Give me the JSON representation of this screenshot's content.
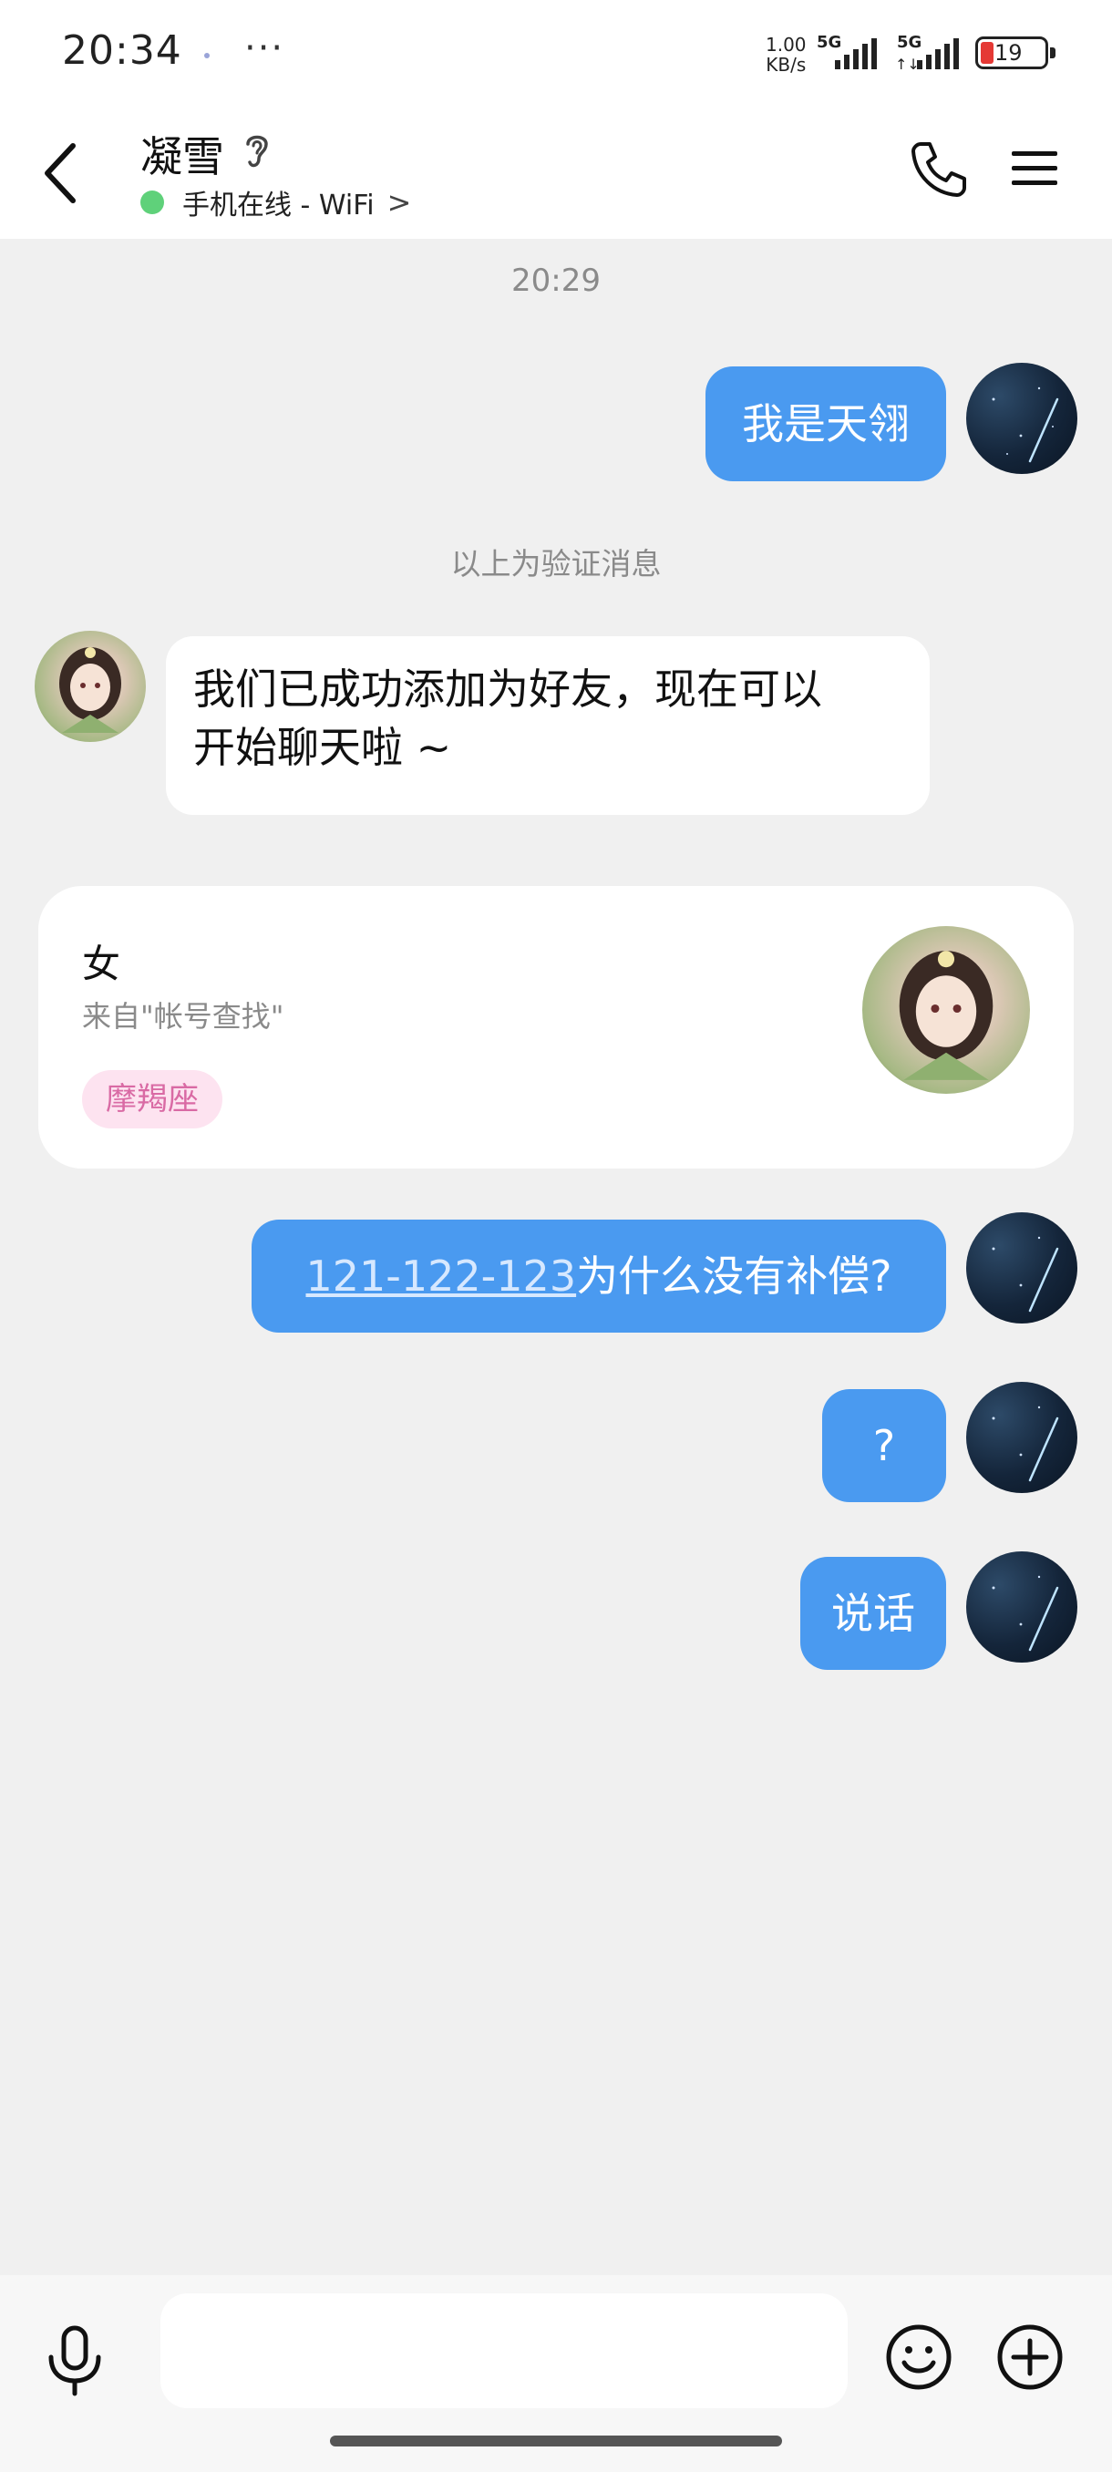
{
  "status_bar": {
    "time": "20:34",
    "more": "···",
    "speed_value": "1.00",
    "speed_unit": "KB/s",
    "network1": "5G",
    "network2": "5G",
    "battery": "19",
    "battery_color": "#e53935"
  },
  "header": {
    "contact_name": "凝雪",
    "online_status": "手机在线 - WiFi",
    "online_chevron": ">",
    "online_color": "#5fd17a",
    "icons": [
      "back-icon",
      "ear-icon",
      "phone-icon",
      "menu-icon"
    ]
  },
  "chat": {
    "timestamp": "20:29",
    "verify_note": "以上为验证消息",
    "messages": [
      {
        "from": "self",
        "text": "我是天翎"
      },
      {
        "from": "friend",
        "text_line1": "我们已成功添加为好友，现在可以",
        "text_line2": "开始聊天啦 ~"
      },
      {
        "from": "self",
        "link": "121-122-123",
        "text": "为什么没有补偿?"
      },
      {
        "from": "self",
        "text": "?"
      },
      {
        "from": "self",
        "text": "说话"
      }
    ],
    "bubble_color": "#4a9af0"
  },
  "profile_card": {
    "gender": "女",
    "source": "来自\"帐号查找\"",
    "tag": "摩羯座",
    "tag_color": "#d96aa4"
  },
  "input_bar": {
    "placeholder": "",
    "icons": [
      "microphone-icon",
      "emoji-icon",
      "plus-icon"
    ]
  }
}
